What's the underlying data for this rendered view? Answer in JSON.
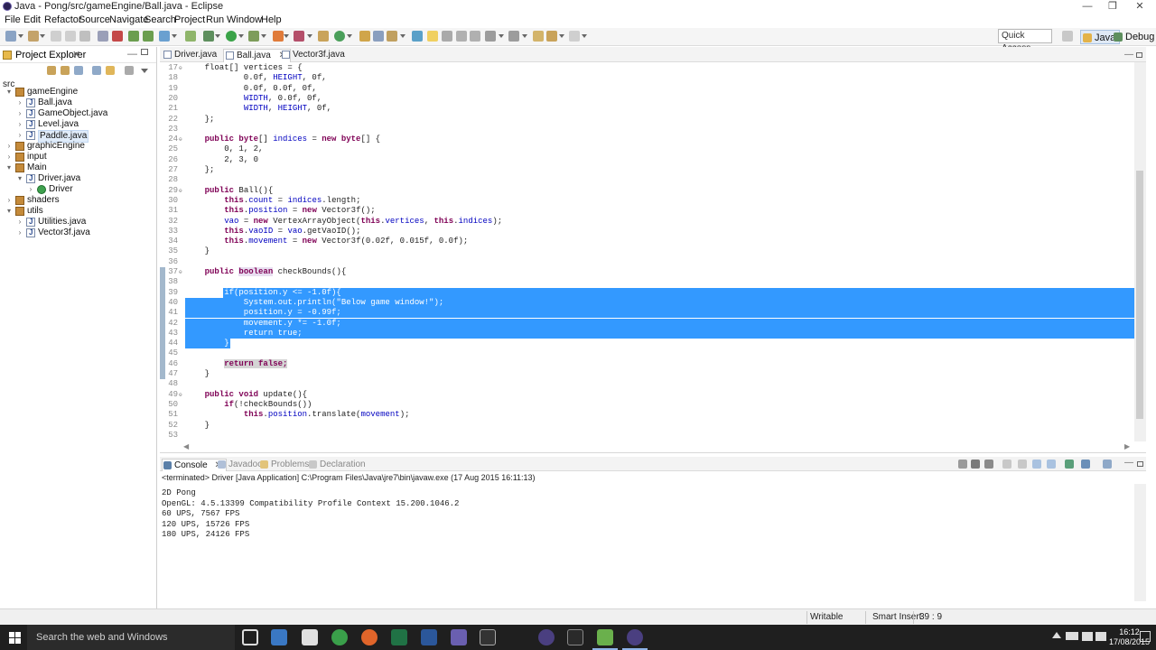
{
  "window": {
    "title": "Java - Pong/src/gameEngine/Ball.java - Eclipse",
    "controls": {
      "minimize": "—",
      "maximize": "❐",
      "close": "✕"
    }
  },
  "menu": [
    "File",
    "Edit",
    "Refactor",
    "Source",
    "Navigate",
    "Search",
    "Project",
    "Run",
    "Window",
    "Help"
  ],
  "toolbar": {
    "quick_access": "Quick Access",
    "perspectives": [
      "Java",
      "Debug"
    ]
  },
  "explorer": {
    "title": "Project Explorer",
    "close": "✕",
    "minimize": "—",
    "root_path": "src",
    "tree": [
      {
        "label": "gameEngine",
        "type": "pkg",
        "depth": 0,
        "arrow": "▾"
      },
      {
        "label": "Ball.java",
        "type": "java",
        "depth": 1,
        "arrow": "›"
      },
      {
        "label": "GameObject.java",
        "type": "java",
        "depth": 1,
        "arrow": "›"
      },
      {
        "label": "Level.java",
        "type": "java",
        "depth": 1,
        "arrow": "›"
      },
      {
        "label": "Paddle.java",
        "type": "java",
        "depth": 1,
        "arrow": "›",
        "selected": true
      },
      {
        "label": "graphicEngine",
        "type": "pkg",
        "depth": 0,
        "arrow": "›"
      },
      {
        "label": "input",
        "type": "pkg",
        "depth": 0,
        "arrow": "›"
      },
      {
        "label": "Main",
        "type": "pkg",
        "depth": 0,
        "arrow": "▾"
      },
      {
        "label": "Driver.java",
        "type": "java",
        "depth": 1,
        "arrow": "▾"
      },
      {
        "label": "Driver",
        "type": "cls",
        "depth": 2,
        "arrow": "›"
      },
      {
        "label": "shaders",
        "type": "pkg",
        "depth": 0,
        "arrow": "›"
      },
      {
        "label": "utils",
        "type": "pkg",
        "depth": 0,
        "arrow": "▾"
      },
      {
        "label": "Utilities.java",
        "type": "java",
        "depth": 1,
        "arrow": "›"
      },
      {
        "label": "Vector3f.java",
        "type": "java",
        "depth": 1,
        "arrow": "›"
      }
    ]
  },
  "editor": {
    "tabs": [
      {
        "label": "Driver.java",
        "active": false
      },
      {
        "label": "Ball.java",
        "active": true
      },
      {
        "label": "Vector3f.java",
        "active": false
      }
    ],
    "lines": [
      {
        "n": "17",
        "fold": "⊖",
        "html": "    float[] vertices = {"
      },
      {
        "n": "18",
        "html": "            0.0f, <span class='fld'>HEIGHT</span>, 0f,"
      },
      {
        "n": "19",
        "html": "            0.0f, 0.0f, 0f,"
      },
      {
        "n": "20",
        "html": "            <span class='fld'>WIDTH</span>, 0.0f, 0f,"
      },
      {
        "n": "21",
        "html": "            <span class='fld'>WIDTH</span>, <span class='fld'>HEIGHT</span>, 0f,"
      },
      {
        "n": "22",
        "html": "    };"
      },
      {
        "n": "23",
        "html": ""
      },
      {
        "n": "24",
        "fold": "⊖",
        "html": "    <span class='kw'>public</span> <span class='kw'>byte</span>[] <span class='fld'>indices</span> = <span class='kw'>new</span> <span class='kw'>byte</span>[] {"
      },
      {
        "n": "25",
        "html": "        0, 1, 2,"
      },
      {
        "n": "26",
        "html": "        2, 3, 0"
      },
      {
        "n": "27",
        "html": "    };"
      },
      {
        "n": "28",
        "html": ""
      },
      {
        "n": "29",
        "fold": "⊖",
        "html": "    <span class='kw'>public</span> Ball(){"
      },
      {
        "n": "30",
        "html": "        <span class='kw'>this</span>.<span class='fld'>count</span> = <span class='fld'>indices</span>.length;"
      },
      {
        "n": "31",
        "html": "        <span class='kw'>this</span>.<span class='fld'>position</span> = <span class='kw'>new</span> Vector3f();"
      },
      {
        "n": "32",
        "html": "        <span class='fld'>vao</span> = <span class='kw'>new</span> VertexArrayObject(<span class='kw'>this</span>.<span class='fld'>vertices</span>, <span class='kw'>this</span>.<span class='fld'>indices</span>);"
      },
      {
        "n": "33",
        "html": "        <span class='kw'>this</span>.<span class='fld'>vaoID</span> = <span class='fld'>vao</span>.getVaoID();"
      },
      {
        "n": "34",
        "html": "        <span class='kw'>this</span>.<span class='fld'>movement</span> = <span class='kw'>new</span> Vector3f(0.02f, 0.015f, 0.0f);"
      },
      {
        "n": "35",
        "html": "    }"
      },
      {
        "n": "36",
        "html": ""
      },
      {
        "n": "37",
        "fold": "⊖",
        "html": "    <span class='kw'>public</span> <span class='kw hl-sel'>boolean</span> checkBounds(){"
      },
      {
        "n": "38",
        "html": ""
      },
      {
        "n": "39",
        "sel": true,
        "html": "        if(position.y &lt;= -1.0f){"
      },
      {
        "n": "40",
        "sel": true,
        "html": "            System.out.println(\"Below game window!\");"
      },
      {
        "n": "41",
        "sel": true,
        "html": "            position.y = -0.99f;"
      },
      {
        "n": "42",
        "sel": true,
        "html": "            movement.y *= -1.0f;"
      },
      {
        "n": "43",
        "sel": true,
        "html": "            return true;"
      },
      {
        "n": "44",
        "sel": true,
        "html": "        }"
      },
      {
        "n": "45",
        "html": ""
      },
      {
        "n": "46",
        "html": "        <span class='kw hl'>return false;</span>"
      },
      {
        "n": "47",
        "html": "    }"
      },
      {
        "n": "48",
        "html": ""
      },
      {
        "n": "49",
        "fold": "⊖",
        "html": "    <span class='kw'>public</span> <span class='kw'>void</span> update(){"
      },
      {
        "n": "50",
        "html": "        <span class='kw'>if</span>(!checkBounds())"
      },
      {
        "n": "51",
        "html": "            <span class='kw'>this</span>.<span class='fld'>position</span>.translate(<span class='fld'>movement</span>);"
      },
      {
        "n": "52",
        "html": "    }"
      },
      {
        "n": "53",
        "html": ""
      }
    ]
  },
  "console": {
    "tabs": [
      {
        "label": "Console",
        "active": true
      },
      {
        "label": "Javadoc",
        "active": false
      },
      {
        "label": "Problems",
        "active": false
      },
      {
        "label": "Declaration",
        "active": false
      }
    ],
    "status": "<terminated> Driver [Java Application] C:\\Program Files\\Java\\jre7\\bin\\javaw.exe (17 Aug 2015 16:11:13)",
    "output": [
      "2D Pong",
      "OpenGL: 4.5.13399 Compatibility Profile Context 15.200.1046.2",
      "60 UPS, 7567 FPS",
      "120 UPS, 15726 FPS",
      "180 UPS, 24126 FPS"
    ]
  },
  "statusbar": {
    "writable": "Writable",
    "insert_mode": "Smart Insert",
    "position": "39 : 9"
  },
  "taskbar": {
    "search_placeholder": "Search the web and Windows",
    "time": "16:12",
    "date": "17/08/2015"
  }
}
